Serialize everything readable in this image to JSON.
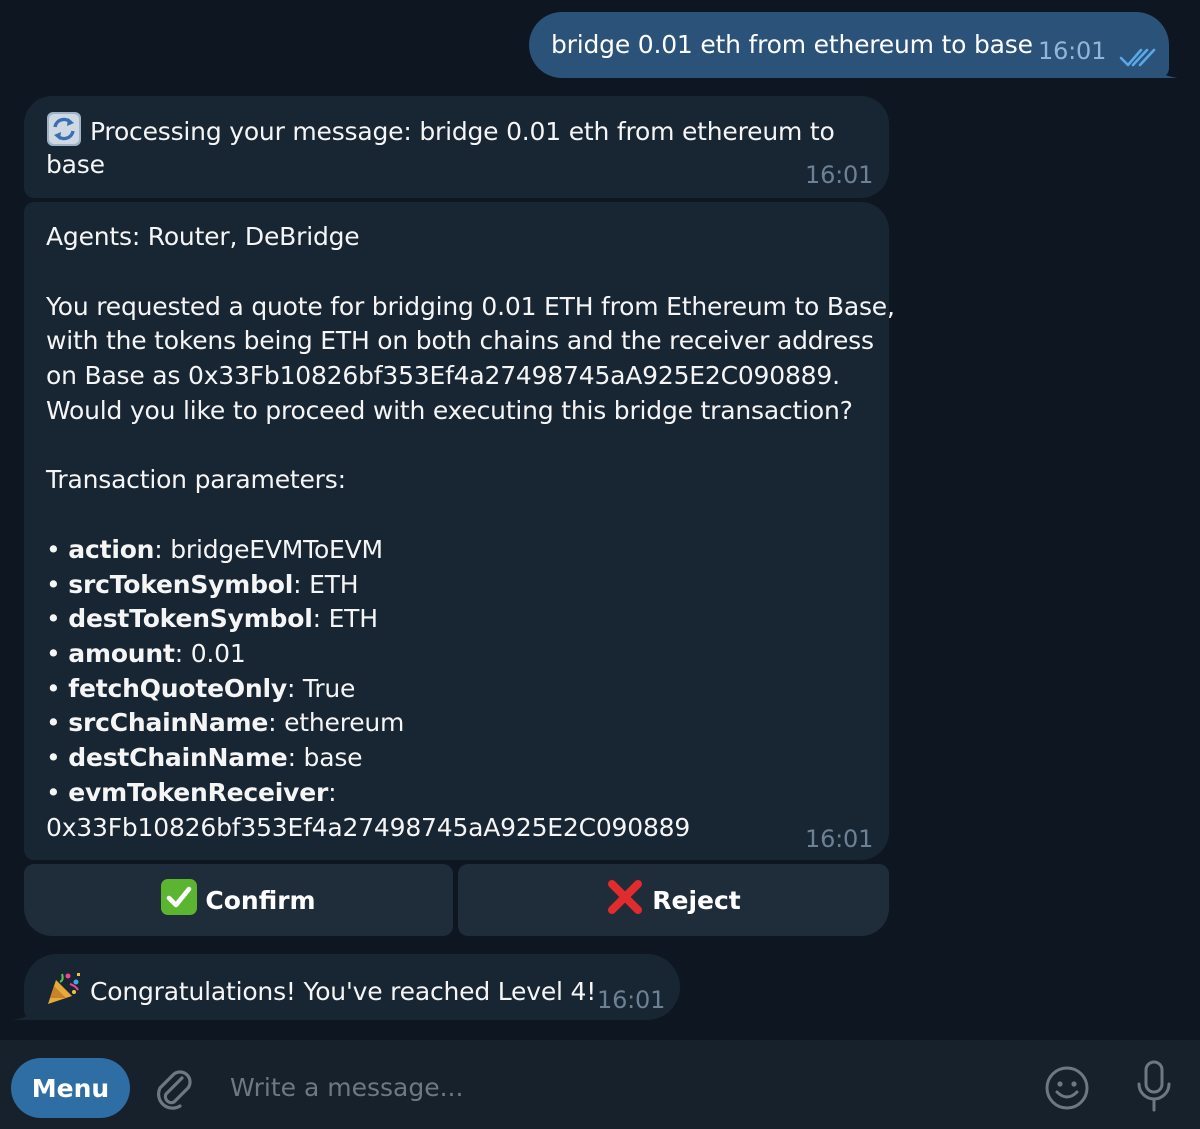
{
  "outgoing": {
    "text": "bridge 0.01 eth from ethereum to base",
    "time": "16:01"
  },
  "processing": {
    "line1": "Processing your message: bridge 0.01 eth from ethereum to",
    "line2": "base",
    "time": "16:01"
  },
  "response": {
    "agents": "Agents: Router, DeBridge",
    "summary": [
      "You requested a quote for bridging 0.01 ETH from Ethereum to Base,",
      "with the tokens being ETH on both chains and the receiver address",
      "on Base as 0x33Fb10826bf353Ef4a27498745aA925E2C090889.",
      "Would you like to proceed with executing this bridge transaction?"
    ],
    "params_heading": "Transaction parameters:",
    "params": [
      {
        "key": "action",
        "value": " bridgeEVMToEVM"
      },
      {
        "key": "srcTokenSymbol",
        "value": " ETH"
      },
      {
        "key": "destTokenSymbol",
        "value": " ETH"
      },
      {
        "key": "amount",
        "value": " 0.01"
      },
      {
        "key": "fetchQuoteOnly",
        "value": " True"
      },
      {
        "key": "srcChainName",
        "value": " ethereum"
      },
      {
        "key": "destChainName",
        "value": " base"
      },
      {
        "key": "evmTokenReceiver",
        "value": ""
      }
    ],
    "receiver_line": "0x33Fb10826bf353Ef4a27498745aA925E2C090889",
    "time": "16:01"
  },
  "keyboard": {
    "confirm_label": "Confirm",
    "reject_label": "Reject"
  },
  "congrats": {
    "text": "Congratulations! You've reached Level 4!",
    "time": "16:01"
  },
  "composer": {
    "menu_label": "Menu",
    "placeholder": "Write a message..."
  },
  "colors": {
    "background": "#0e1621",
    "outgoing_bubble": "#2b5278",
    "incoming_bubble": "#182533",
    "menu_button": "#2f6ea5",
    "check_color": "#5aa8e8"
  },
  "icons": {
    "processing": "refresh-arrows-emoji",
    "confirm": "green-check-emoji",
    "reject": "red-cross-emoji",
    "congrats": "party-popper-emoji",
    "read_status": "double-check-icon",
    "attach": "paperclip-icon",
    "emoji": "smile-icon",
    "voice": "microphone-icon"
  }
}
